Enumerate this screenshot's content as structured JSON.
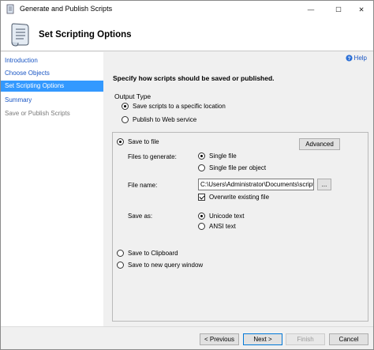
{
  "window": {
    "title": "Generate and Publish Scripts",
    "controls": {
      "minimize": "—",
      "maximize": "☐",
      "close": "✕"
    }
  },
  "header": {
    "title": "Set Scripting Options",
    "icon": "scroll-icon"
  },
  "sidebar": {
    "items": [
      {
        "label": "Introduction",
        "state": "link"
      },
      {
        "label": "Choose Objects",
        "state": "link"
      },
      {
        "label": "Set Scripting Options",
        "state": "active"
      },
      {
        "label": "Summary",
        "state": "link"
      },
      {
        "label": "Save or Publish Scripts",
        "state": "disabled"
      }
    ]
  },
  "main": {
    "help_label": "Help",
    "instruction": "Specify how scripts should be saved or published.",
    "output_type": {
      "label": "Output Type",
      "options": [
        {
          "label": "Save scripts to a specific location",
          "checked": true
        },
        {
          "label": "Publish to Web service",
          "checked": false
        }
      ]
    },
    "save_to_file": {
      "label": "Save to file",
      "checked": true,
      "advanced_label": "Advanced",
      "files_to_generate": {
        "label": "Files to generate:",
        "options": [
          {
            "label": "Single file",
            "checked": true
          },
          {
            "label": "Single file per object",
            "checked": false
          }
        ]
      },
      "file_name": {
        "label": "File name:",
        "value": "C:\\Users\\Administrator\\Documents\\script.sql",
        "browse_label": "..."
      },
      "overwrite": {
        "label": "Overwrite existing file",
        "checked": true
      },
      "save_as": {
        "label": "Save as:",
        "options": [
          {
            "label": "Unicode text",
            "checked": true
          },
          {
            "label": "ANSI text",
            "checked": false
          }
        ]
      }
    },
    "save_to_clipboard": {
      "label": "Save to Clipboard",
      "checked": false
    },
    "save_to_query_window": {
      "label": "Save to new query window",
      "checked": false
    }
  },
  "footer": {
    "previous_label": "< Previous",
    "next_label": "Next >",
    "finish_label": "Finish",
    "cancel_label": "Cancel"
  },
  "colors": {
    "accent": "#3399ff",
    "link": "#1a56c4",
    "primary_border": "#0078d7"
  }
}
